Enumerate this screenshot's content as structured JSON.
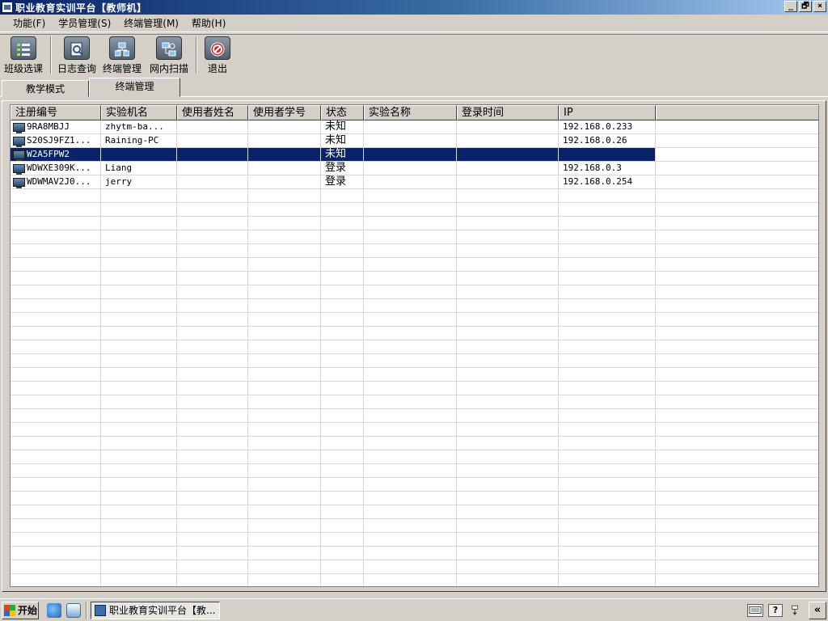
{
  "window": {
    "title": "职业教育实训平台【教师机】",
    "controls": [
      "_",
      "🗗",
      "×"
    ]
  },
  "menu": [
    {
      "label": "功能(F)"
    },
    {
      "label": "学员管理(S)"
    },
    {
      "label": "终端管理(M)"
    },
    {
      "label": "帮助(H)"
    }
  ],
  "toolbar": {
    "class_select": "班级选课",
    "log_query": "日志查询",
    "terminal_manage": "终端管理",
    "lan_scan": "网内扫描",
    "exit": "退出"
  },
  "tabs": {
    "teaching": "教学模式",
    "terminal": "终端管理"
  },
  "grid": {
    "columns": [
      "注册编号",
      "实验机名",
      "使用者姓名",
      "使用者学号",
      "状态",
      "实验名称",
      "登录时间",
      "IP"
    ],
    "rows": [
      [
        "9RA8MBJJ",
        "zhytm-ba...",
        "",
        "",
        "未知",
        "",
        "",
        "192.168.0.233"
      ],
      [
        "S20SJ9FZ1...",
        "Raining-PC",
        "",
        "",
        "未知",
        "",
        "",
        "192.168.0.26"
      ],
      [
        "W2A5FPW2",
        "",
        "",
        "",
        "未知",
        "",
        "",
        ""
      ],
      [
        "WDWXE309K...",
        "Liang",
        "",
        "",
        "登录",
        "",
        "",
        "192.168.0.3"
      ],
      [
        "WDWMAV2J0...",
        "jerry",
        "",
        "",
        "登录",
        "",
        "",
        "192.168.0.254"
      ]
    ],
    "selected_row": 2
  },
  "taskbar": {
    "start_label": "开始",
    "task_label": "职业教育实训平台【教...",
    "tray_help": "?",
    "expand": "«"
  },
  "colors": {
    "title_start": "#0a246a",
    "selection": "#0a246a",
    "face": "#d4d0c8"
  }
}
